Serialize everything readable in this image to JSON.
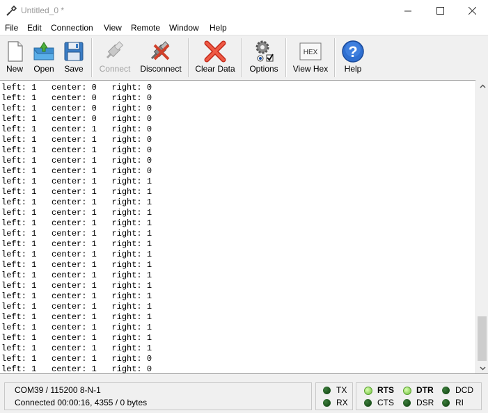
{
  "window": {
    "title": "Untitled_0 *",
    "minimize_icon": "minimize-icon",
    "maximize_icon": "maximize-icon",
    "close_icon": "close-icon"
  },
  "menu": [
    "File",
    "Edit",
    "Connection",
    "View",
    "Remote",
    "Window",
    "Help"
  ],
  "toolbar": {
    "new": "New",
    "open": "Open",
    "save": "Save",
    "connect": "Connect",
    "disconnect": "Disconnect",
    "clear": "Clear Data",
    "options": "Options",
    "viewhex": "View Hex",
    "hex_icon_text": "HEX",
    "help": "Help"
  },
  "terminal": {
    "lines": [
      "left: 1   center: 0   right: 0",
      "left: 1   center: 0   right: 0",
      "left: 1   center: 0   right: 0",
      "left: 1   center: 0   right: 0",
      "left: 1   center: 1   right: 0",
      "left: 1   center: 1   right: 0",
      "left: 1   center: 1   right: 0",
      "left: 1   center: 1   right: 0",
      "left: 1   center: 1   right: 0",
      "left: 1   center: 1   right: 1",
      "left: 1   center: 1   right: 1",
      "left: 1   center: 1   right: 1",
      "left: 1   center: 1   right: 1",
      "left: 1   center: 1   right: 1",
      "left: 1   center: 1   right: 1",
      "left: 1   center: 1   right: 1",
      "left: 1   center: 1   right: 1",
      "left: 1   center: 1   right: 1",
      "left: 1   center: 1   right: 1",
      "left: 1   center: 1   right: 1",
      "left: 1   center: 1   right: 1",
      "left: 1   center: 1   right: 1",
      "left: 1   center: 1   right: 1",
      "left: 1   center: 1   right: 1",
      "left: 1   center: 1   right: 1",
      "left: 1   center: 1   right: 1",
      "left: 1   center: 1   right: 0",
      "left: 1   center: 1   right: 0"
    ]
  },
  "status": {
    "port": "COM39 / 115200 8-N-1",
    "connection": "Connected 00:00:16, 4355 / 0 bytes"
  },
  "leds": {
    "tx": "TX",
    "rx": "RX",
    "rts": "RTS",
    "cts": "CTS",
    "dtr": "DTR",
    "dsr": "DSR",
    "dcd": "DCD",
    "ri": "RI"
  }
}
